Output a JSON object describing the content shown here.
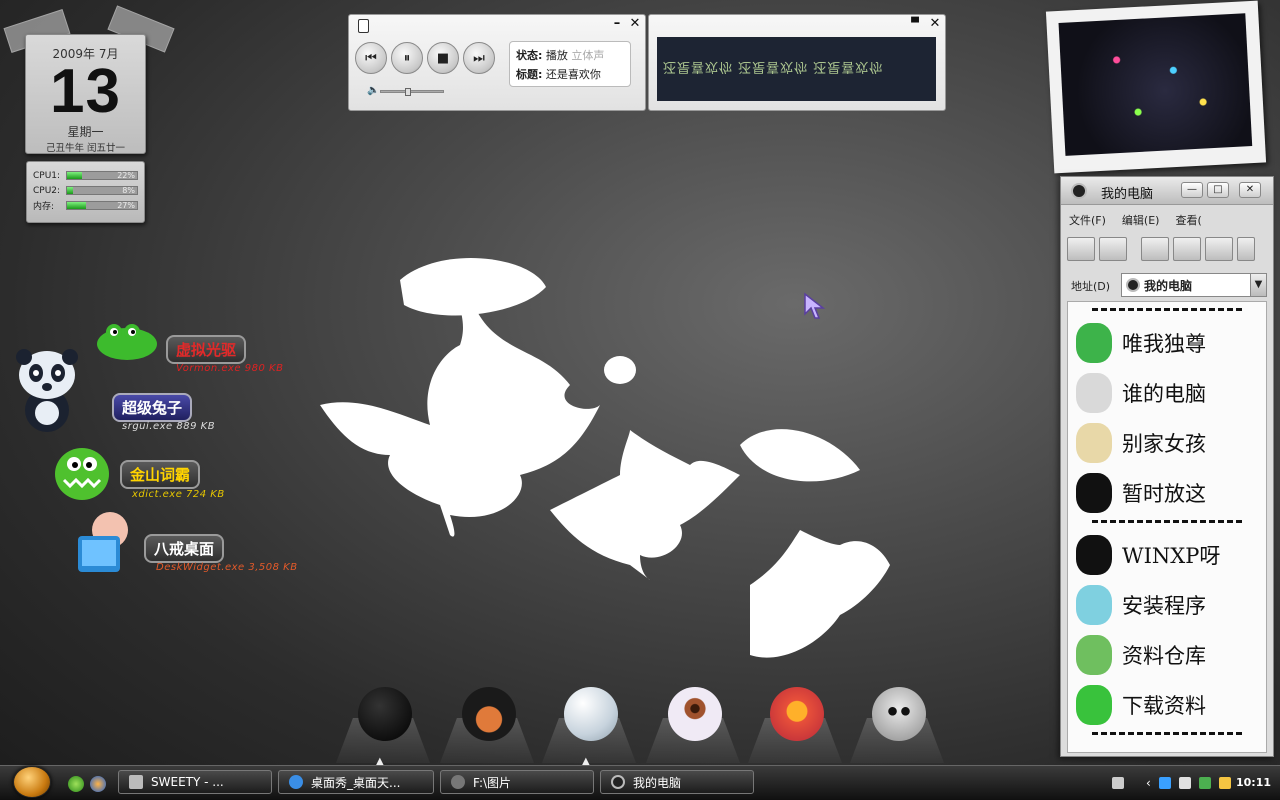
{
  "calendar": {
    "year_month": "2009年 7月",
    "day": "13",
    "weekday": "星期一",
    "lunar": "己丑牛年 闰五廿一"
  },
  "cpu_monitor": {
    "rows": [
      {
        "label": "CPU1:",
        "percent": 22,
        "text": "22%"
      },
      {
        "label": "CPU2:",
        "percent": 8,
        "text": "8%"
      },
      {
        "label": "内存:",
        "percent": 27,
        "text": "27%"
      }
    ]
  },
  "player": {
    "status_label": "状态:",
    "status_value": "播放",
    "status_extra": "立体声",
    "title_label": "标题:",
    "title_value": "还是喜欢你",
    "controls": [
      "previous",
      "pause",
      "stop",
      "next"
    ],
    "volume": 0.4
  },
  "visualizer": {
    "scrolling_text": "还是喜欢你 还是喜欢你 还是喜欢你"
  },
  "desktop_icons": [
    {
      "label": "虚拟光驱",
      "sub": "Vormon.exe 980 KB",
      "color": "#e22a2a"
    },
    {
      "label": "超级兔子",
      "sub": "srgui.exe 889 KB",
      "color": "#ffffff"
    },
    {
      "label": "金山词霸",
      "sub": "xdict.exe 724 KB",
      "color": "#ffd400"
    },
    {
      "label": "八戒桌面",
      "sub": "DeskWidget.exe 3,508 KB",
      "color": "#ffffff"
    }
  ],
  "dock": {
    "items": [
      "soot-sprite-icon",
      "hedgehog-icon",
      "golf-ball-icon",
      "eyeball-icon",
      "fruit-icon",
      "skull-icon"
    ]
  },
  "my_computer": {
    "title": "我的电脑",
    "menu": [
      "文件(F)",
      "编辑(E)",
      "查看("
    ],
    "address_label": "地址(D)",
    "address_value": "我的电脑",
    "items": [
      {
        "label": "唯我独尊",
        "color": "#3db34a"
      },
      {
        "label": "谁的电脑",
        "color": "#d9d9d9"
      },
      {
        "label": "别家女孩",
        "color": "#e8d8a8"
      },
      {
        "label": "暂时放这",
        "color": "#111111"
      },
      {
        "label": "WINXP呀",
        "color": "#111111"
      },
      {
        "label": "安装程序",
        "color": "#7fd0e0"
      },
      {
        "label": "资料仓库",
        "color": "#6fbf5f"
      },
      {
        "label": "下载资料",
        "color": "#39c23c"
      }
    ]
  },
  "taskbar": {
    "tasks": [
      {
        "label": "SWEETY - ..."
      },
      {
        "label": "桌面秀_桌面天..."
      },
      {
        "label": "F:\\图片"
      },
      {
        "label": "我的电脑"
      }
    ],
    "clock": "10:11"
  },
  "colors": {
    "desktop_bg": "#3a3a3a",
    "cpu_bar": "#2db52d"
  }
}
